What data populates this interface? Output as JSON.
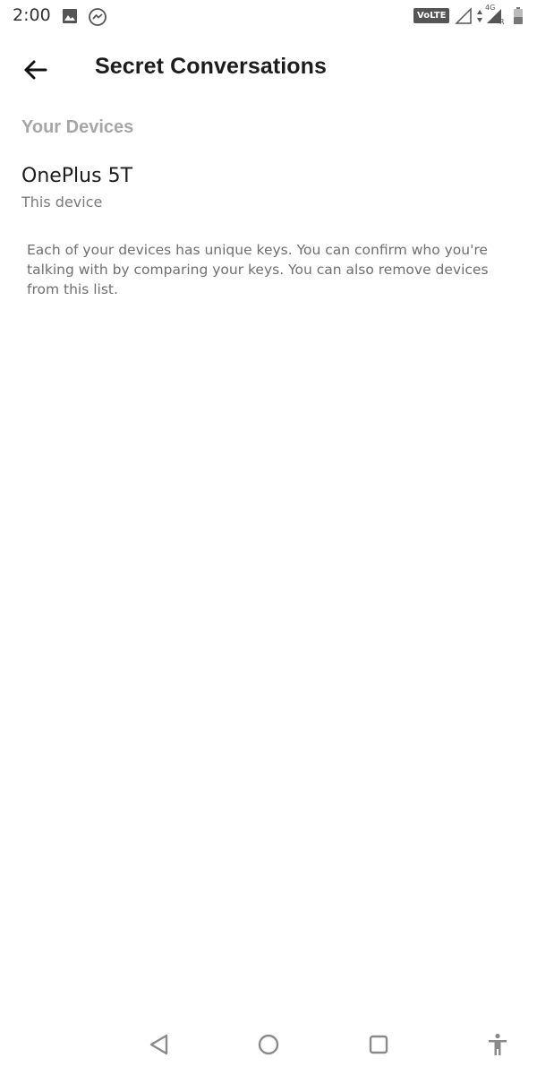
{
  "status_bar": {
    "time": "2:00",
    "volte": "VoLTE",
    "network": "4G",
    "roaming": "R",
    "icons": [
      "image-icon",
      "messenger-icon",
      "volte-icon",
      "signal-empty-icon",
      "signal-icon",
      "battery-icon"
    ]
  },
  "app_bar": {
    "title": "Secret Conversations",
    "back_icon": "back-arrow-icon"
  },
  "section": {
    "header": "Your Devices"
  },
  "devices": [
    {
      "name": "OnePlus 5T",
      "subtitle": "This device"
    }
  ],
  "description": "Each of your devices has unique keys. You can confirm who you're talking with by comparing your keys. You can also remove devices from this list.",
  "nav_bar": {
    "icons": [
      "nav-back-icon",
      "nav-home-icon",
      "nav-recents-icon",
      "accessibility-icon"
    ]
  },
  "colors": {
    "title": "#1c1c1c",
    "section_header": "#a6a6a6",
    "secondary_text": "#7a7a7a",
    "body_text": "#6f6f6f",
    "nav_icons": "#8a8a8a"
  }
}
